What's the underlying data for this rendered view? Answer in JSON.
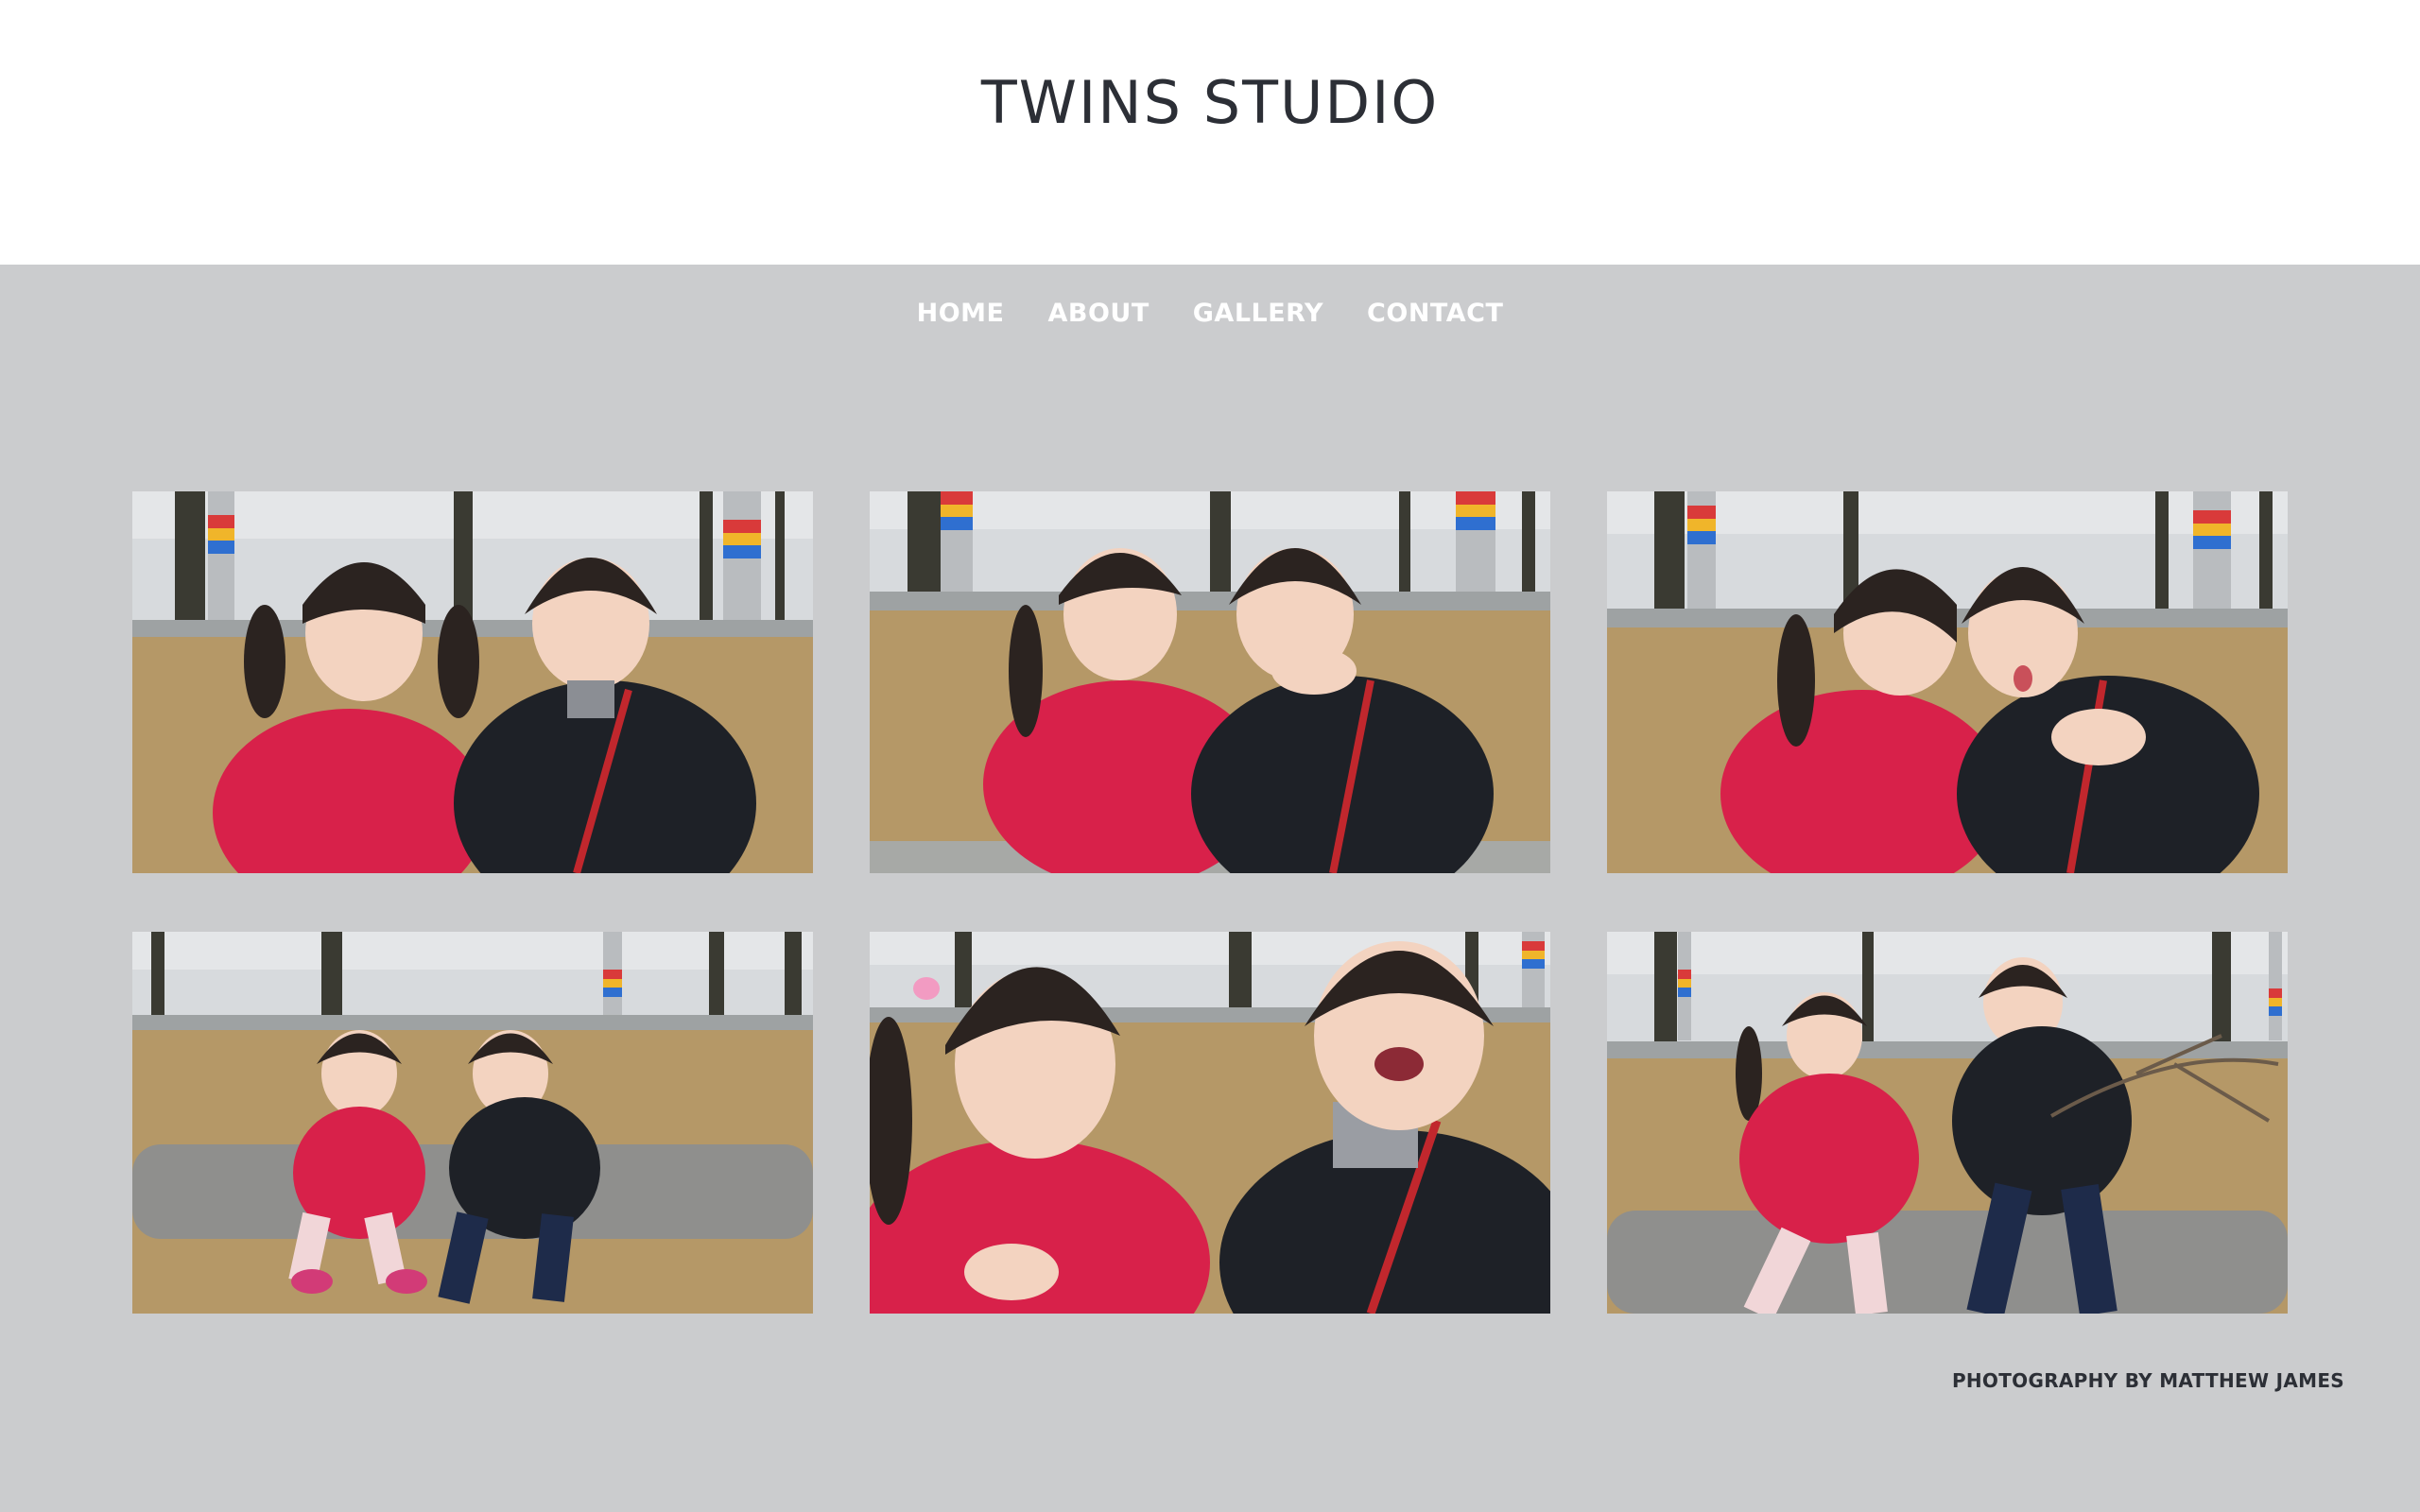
{
  "header": {
    "title": "TWINS STUDIO"
  },
  "nav": {
    "items": [
      {
        "label": "HOME"
      },
      {
        "label": "ABOUT"
      },
      {
        "label": "GALLERY"
      },
      {
        "label": "CONTACT"
      }
    ]
  },
  "gallery": {
    "photos": [
      {
        "name": "photo-twins-sitting"
      },
      {
        "name": "photo-twins-hug"
      },
      {
        "name": "photo-twins-cheek-hug"
      },
      {
        "name": "photo-twins-on-rock"
      },
      {
        "name": "photo-twins-laughing"
      },
      {
        "name": "photo-twins-with-stick"
      }
    ]
  },
  "footer": {
    "credit": "PHOTOGRAPHY BY MATTHEW JAMES"
  },
  "colors": {
    "page_background": "#cbccce",
    "header_background": "#ffffff",
    "title_text": "#2c2f36",
    "nav_text": "#ffffff",
    "jacket_red": "#d8214a",
    "jacket_black": "#1e2127",
    "grass": "#b59867"
  }
}
